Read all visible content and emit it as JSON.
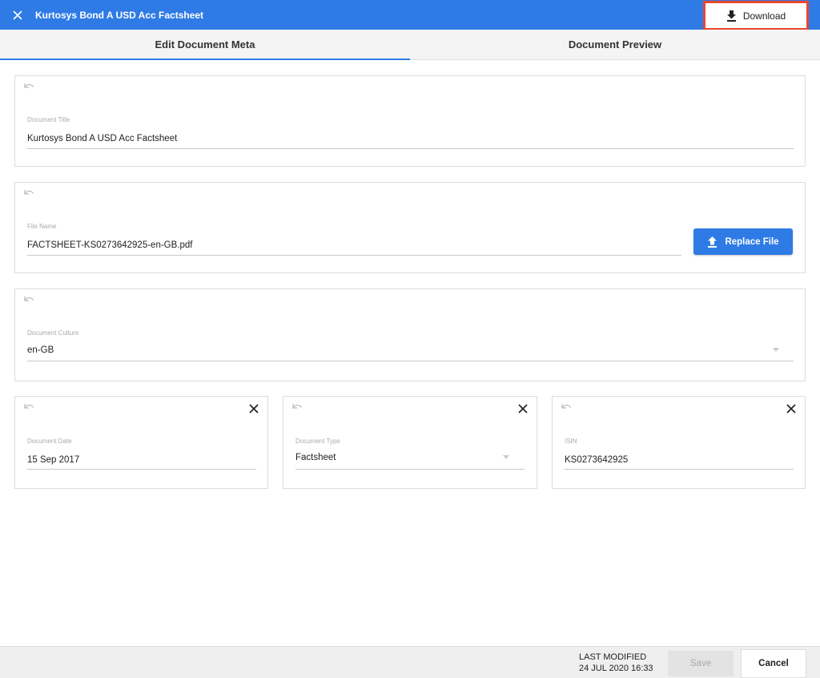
{
  "header": {
    "title": "Kurtosys Bond A USD Acc Factsheet",
    "download_label": "Download",
    "accent_color": "#2f7be5",
    "highlight_color": "#e8472f"
  },
  "tabs": [
    {
      "label": "Edit Document Meta",
      "active": true
    },
    {
      "label": "Document Preview",
      "active": false
    }
  ],
  "fields": {
    "title": {
      "label": "Document Title",
      "value": "Kurtosys Bond A USD Acc Factsheet"
    },
    "file": {
      "label": "File Name",
      "value": "FACTSHEET-KS0273642925-en-GB.pdf",
      "button_label": "Replace File"
    },
    "culture": {
      "label": "Document Culture",
      "value": "en-GB"
    },
    "date": {
      "label": "Document Date",
      "value": "15 Sep 2017"
    },
    "type": {
      "label": "Document Type",
      "value": "Factsheet"
    },
    "isin": {
      "label": "ISIN",
      "value": "KS0273642925"
    }
  },
  "footer": {
    "last_modified_label": "LAST MODIFIED",
    "last_modified_value": "24 JUL 2020 16:33",
    "save_label": "Save",
    "cancel_label": "Cancel"
  },
  "icons": {
    "close": "close-icon",
    "download": "download-icon",
    "upload": "upload-icon",
    "undo": "undo-icon",
    "clear": "clear-icon",
    "dropdown": "chevron-down-icon"
  }
}
